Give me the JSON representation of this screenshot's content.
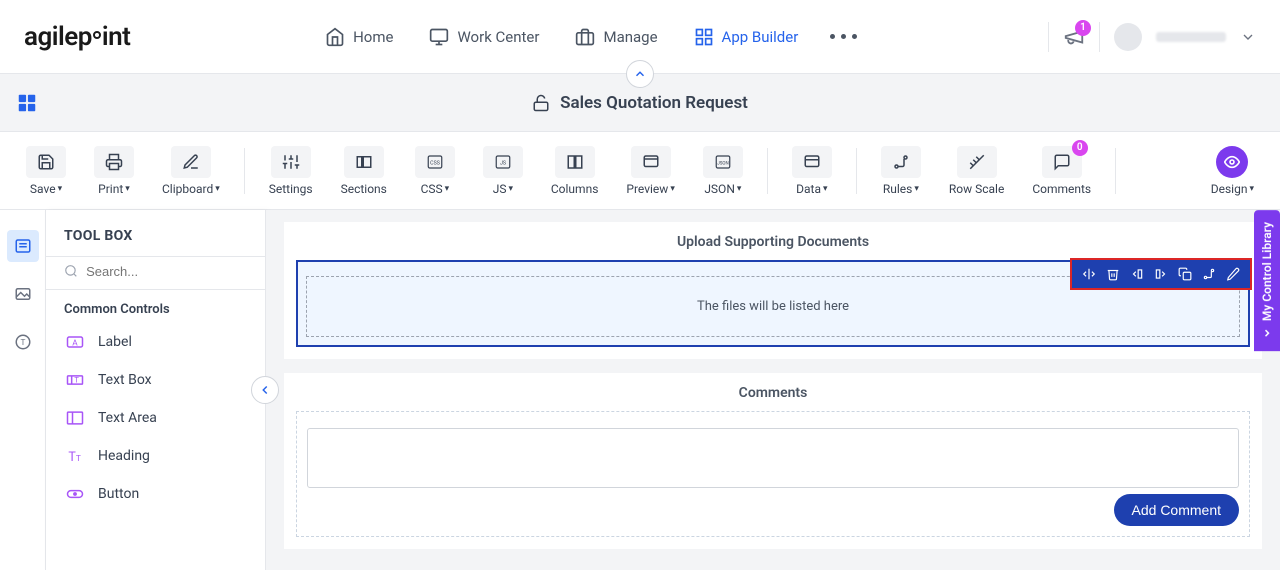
{
  "nav": {
    "home": "Home",
    "work_center": "Work Center",
    "manage": "Manage",
    "app_builder": "App Builder",
    "notif_count": "1"
  },
  "title": "Sales Quotation Request",
  "toolbar": {
    "save": "Save",
    "print": "Print",
    "clipboard": "Clipboard",
    "settings": "Settings",
    "sections": "Sections",
    "css": "CSS",
    "js": "JS",
    "columns": "Columns",
    "preview": "Preview",
    "json": "JSON",
    "data": "Data",
    "rules": "Rules",
    "row_scale": "Row Scale",
    "comments": "Comments",
    "comments_count": "0",
    "design": "Design"
  },
  "toolbox": {
    "title": "TOOL BOX",
    "search_placeholder": "Search...",
    "group": "Common Controls",
    "ctrl_label": "Label",
    "ctrl_textbox": "Text Box",
    "ctrl_textarea": "Text Area",
    "ctrl_heading": "Heading",
    "ctrl_button": "Button"
  },
  "canvas": {
    "upload_title": "Upload Supporting Documents",
    "files_placeholder": "The files will be listed here",
    "comments_title": "Comments",
    "add_comment": "Add Comment"
  },
  "right_tab": "My Control Library"
}
